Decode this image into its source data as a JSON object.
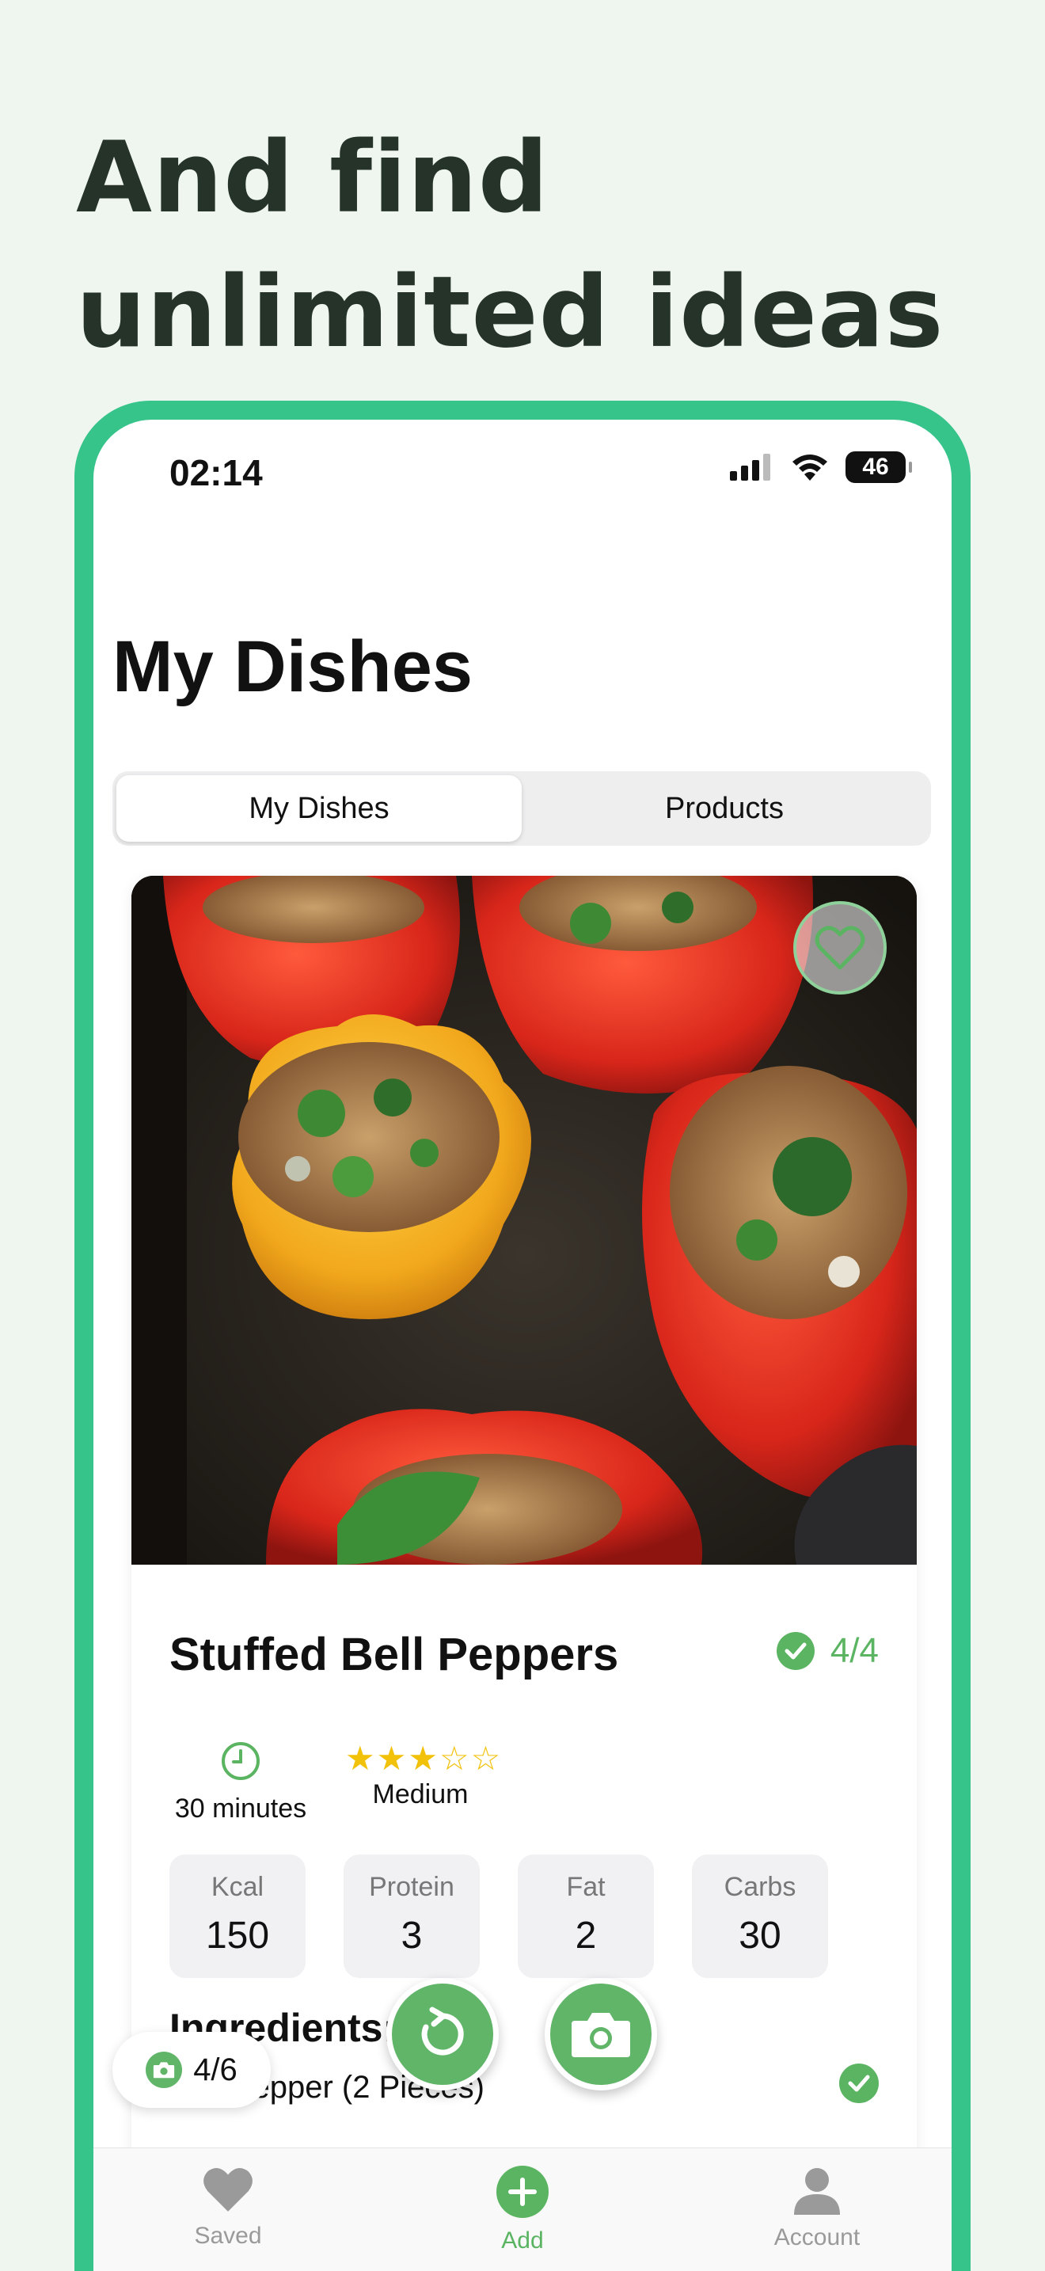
{
  "headline": {
    "line1": "And find",
    "line2": "unlimited ideas"
  },
  "status_bar": {
    "time": "02:14",
    "battery": "46"
  },
  "page_title": "My Dishes",
  "segments": [
    {
      "label": "My Dishes",
      "active": true
    },
    {
      "label": "Products",
      "active": false
    }
  ],
  "dish": {
    "name": "Stuffed Bell Peppers",
    "progress": "4/4",
    "time": "30 minutes",
    "rating": 3,
    "rating_max": 5,
    "difficulty": "Medium",
    "macros": [
      {
        "label": "Kcal",
        "value": "150"
      },
      {
        "label": "Protein",
        "value": "3"
      },
      {
        "label": "Fat",
        "value": "2"
      },
      {
        "label": "Carbs",
        "value": "30"
      }
    ],
    "ingredients_title": "Ingredients:",
    "ingredients": [
      {
        "name": "Bell Pepper (2 Pieces)",
        "checked": true
      }
    ]
  },
  "photo_counter": "4/6",
  "tabbar": [
    {
      "label": "Saved",
      "icon": "heart-icon",
      "active": false
    },
    {
      "label": "Add",
      "icon": "plus-circle-icon",
      "active": true
    },
    {
      "label": "Account",
      "icon": "person-icon",
      "active": false
    }
  ],
  "colors": {
    "accent": "#5bb462",
    "phone_frame": "#36c48b",
    "background": "#eff6ef",
    "star": "#f2c10a"
  }
}
